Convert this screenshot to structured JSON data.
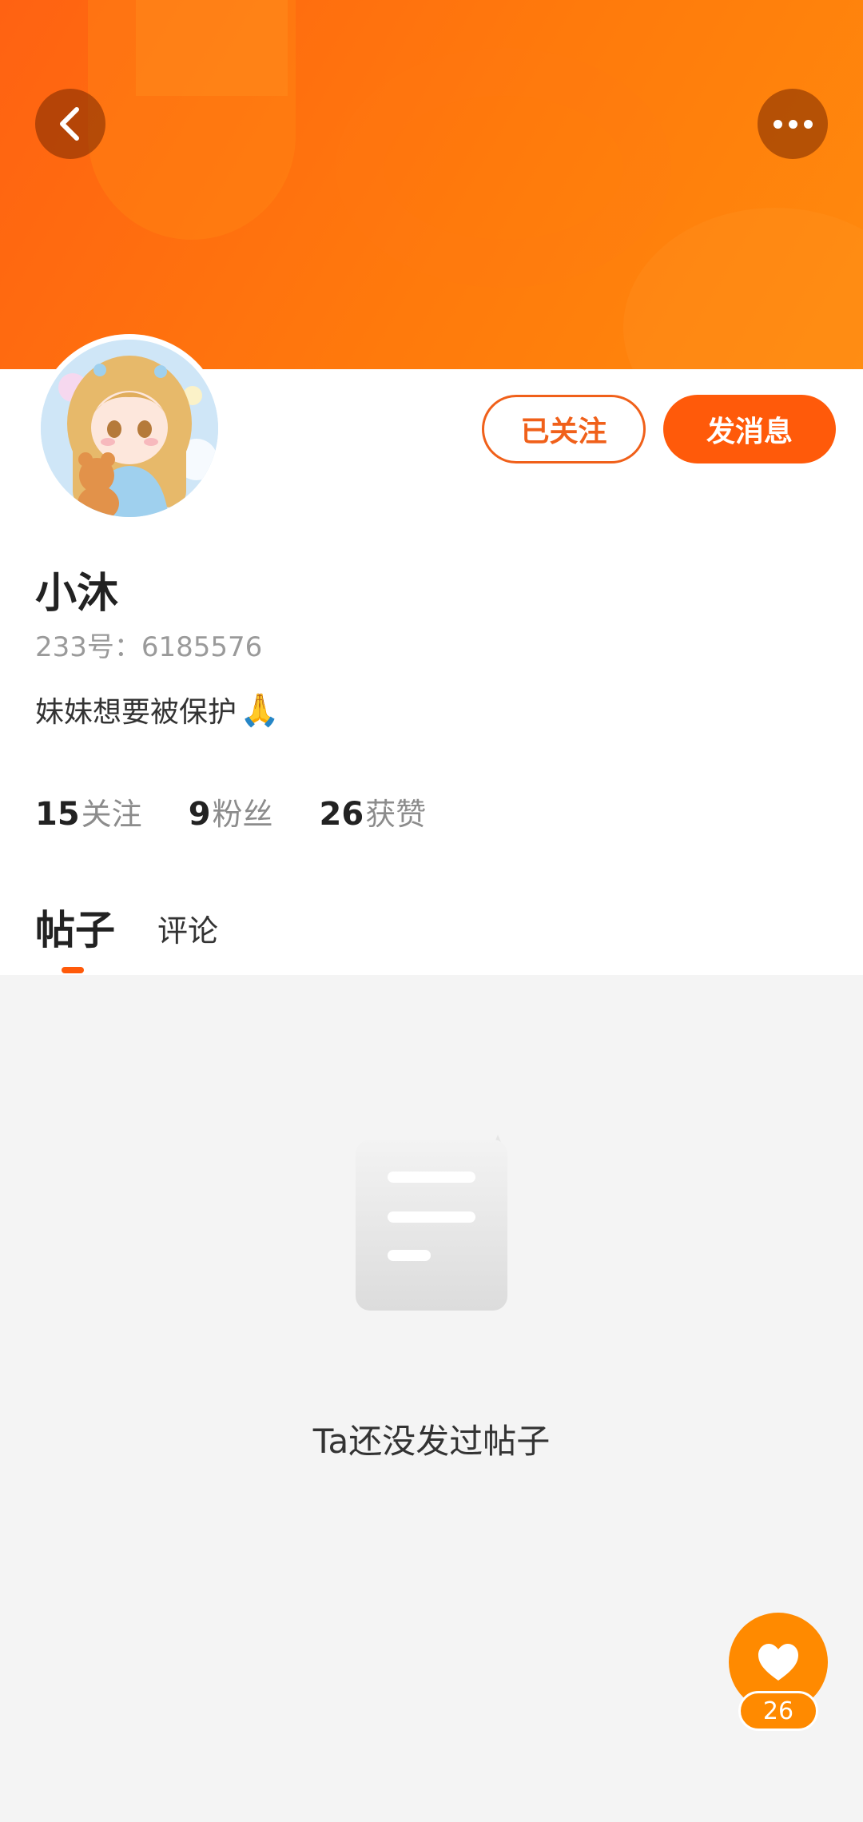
{
  "header": {
    "back_icon": "chevron-left-icon",
    "more_icon": "more-dots-icon"
  },
  "profile": {
    "name": "小沐",
    "uid": "233号：6185576",
    "bio": "妹妹想要被保护",
    "bio_emoji": "🙏",
    "follow_button": "已关注",
    "message_button": "发消息",
    "stats": {
      "following_count": "15",
      "following_label": "关注",
      "followers_count": "9",
      "followers_label": "粉丝",
      "likes_count": "26",
      "likes_label": "获赞"
    }
  },
  "tabs": {
    "posts": "帖子",
    "comments": "评论"
  },
  "empty_state": {
    "icon": "document-icon",
    "text": "Ta还没发过帖子"
  },
  "like_fab": {
    "icon": "heart-icon",
    "count": "26"
  },
  "colors": {
    "accent": "#ff5a0a",
    "banner_start": "#ff6212",
    "banner_end": "#ff8a0d",
    "fab": "#ff8a00"
  }
}
